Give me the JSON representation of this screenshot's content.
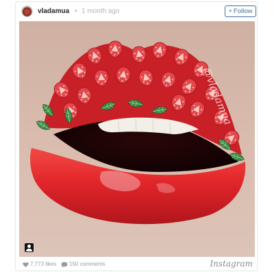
{
  "post": {
    "username": "vladamua",
    "separator": "•",
    "timestamp": "1 month ago",
    "follow_label": "Follow",
    "follow_plus": "+",
    "watermark": "@vladamua",
    "likes": "7,773 likes",
    "comments": "150 comments",
    "brand": "Instagram"
  },
  "icons": {
    "avatar": "avatar-icon",
    "heart": "heart-icon",
    "comment": "comment-bubble-icon",
    "tagged_user": "user-tag-icon"
  },
  "colors": {
    "accent": "#3f729b",
    "lip_red": "#e8282c",
    "strawberry": "#e2474a",
    "leaf": "#3d8a4a",
    "skin": "#d7b8a8"
  }
}
